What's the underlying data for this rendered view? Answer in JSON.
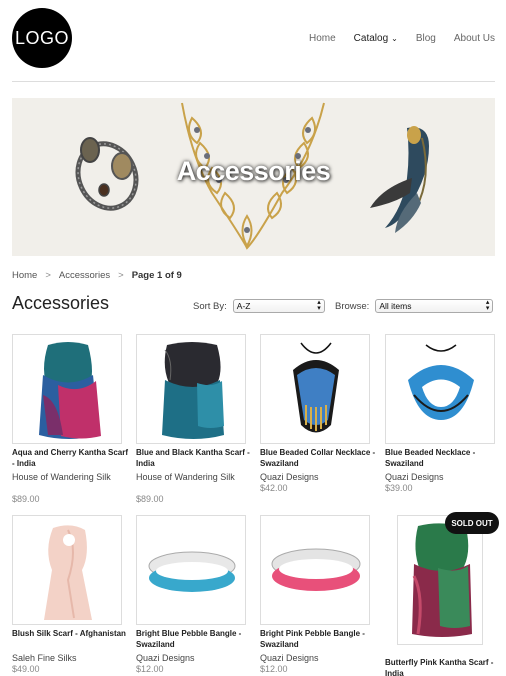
{
  "header": {
    "logo_text": "LOGO",
    "nav": [
      {
        "label": "Home"
      },
      {
        "label": "Catalog"
      },
      {
        "label": "Blog"
      },
      {
        "label": "About Us"
      }
    ]
  },
  "banner": {
    "title": "Accessories"
  },
  "breadcrumb": {
    "home": "Home",
    "section": "Accessories",
    "current": "Page 1 of 9"
  },
  "page_title": "Accessories",
  "controls": {
    "sort_label": "Sort By:",
    "sort_value": "A-Z",
    "browse_label": "Browse:",
    "browse_value": "All items"
  },
  "products": [
    {
      "name": "Aqua and Cherry Kantha Scarf - India",
      "vendor": "House of Wandering Silk",
      "price": "$89.00"
    },
    {
      "name": "Blue and Black Kantha Scarf - India",
      "vendor": "House of Wandering Silk",
      "price": "$89.00"
    },
    {
      "name": "Blue Beaded Collar Necklace - Swaziland",
      "vendor": "Quazi Designs",
      "price": "$42.00"
    },
    {
      "name": "Blue Beaded Necklace - Swaziland",
      "vendor": "Quazi Designs",
      "price": "$39.00"
    },
    {
      "name": "Blush Silk Scarf - Afghanistan",
      "vendor": "Saleh Fine Silks",
      "price": "$49.00"
    },
    {
      "name": "Bright Blue Pebble Bangle - Swaziland",
      "vendor": "Quazi Designs",
      "price": "$12.00"
    },
    {
      "name": "Bright Pink Pebble Bangle - Swaziland",
      "vendor": "Quazi Designs",
      "price": "$12.00"
    },
    {
      "name": "Butterfly Pink Kantha Scarf - India",
      "vendor": "",
      "price": ""
    }
  ],
  "sold_out_badge": "SOLD OUT"
}
